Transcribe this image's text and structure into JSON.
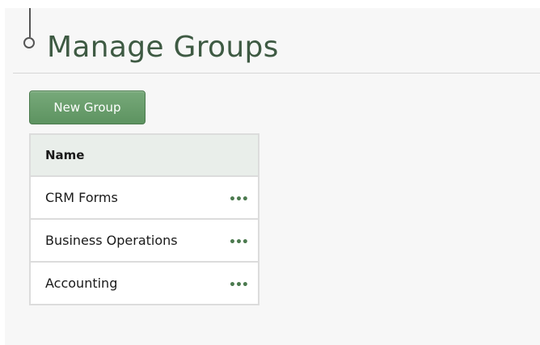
{
  "page": {
    "title": "Manage Groups"
  },
  "toolbar": {
    "new_group_label": "New Group"
  },
  "table": {
    "header": "Name",
    "rows": [
      {
        "name": "CRM Forms",
        "actions": "•••"
      },
      {
        "name": "Business Operations",
        "actions": "•••"
      },
      {
        "name": "Accounting",
        "actions": "•••"
      }
    ]
  },
  "colors": {
    "title": "#3e5a43",
    "button_bg": "#6a9e6d",
    "header_bg": "#e9eeea",
    "actions_icon": "#4c7a4f"
  },
  "icons": {
    "row_actions": "more-horizontal-icon",
    "timeline_marker": "timeline-circle-icon"
  }
}
